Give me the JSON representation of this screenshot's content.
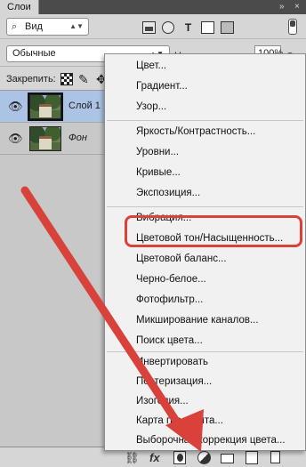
{
  "window": {
    "tab_title": "Слои",
    "collapse_glyph": "»",
    "close_glyph": "×"
  },
  "filter": {
    "type_value": "Вид",
    "search_icon": "⌕"
  },
  "blending": {
    "mode": "Обычные",
    "opacity_label": "Непрозрачность:",
    "opacity_value": "100%"
  },
  "lock": {
    "label": "Закрепить:"
  },
  "layers": [
    {
      "name": "Слой 1",
      "selected": true
    },
    {
      "name": "Фон",
      "selected": false
    }
  ],
  "menu": {
    "items": [
      "Цвет...",
      "Градиент...",
      "Узор...",
      "Яркость/Контрастность...",
      "Уровни...",
      "Кривые...",
      "Экспозиция...",
      "Вибрация...",
      "Цветовой тон/Насыщенность...",
      "Цветовой баланс...",
      "Черно-белое...",
      "Фотофильтр...",
      "Микширование каналов...",
      "Поиск цвета...",
      "Инвертировать",
      "Постеризация...",
      "Изогелия...",
      "Карта градиента...",
      "Выборочная коррекция цвета..."
    ],
    "highlighted_item": "Цветовой тон/Насыщенность..."
  },
  "bottom_bar": {
    "fx_label": "fx"
  },
  "annotation": {
    "color": "#d9423b"
  }
}
